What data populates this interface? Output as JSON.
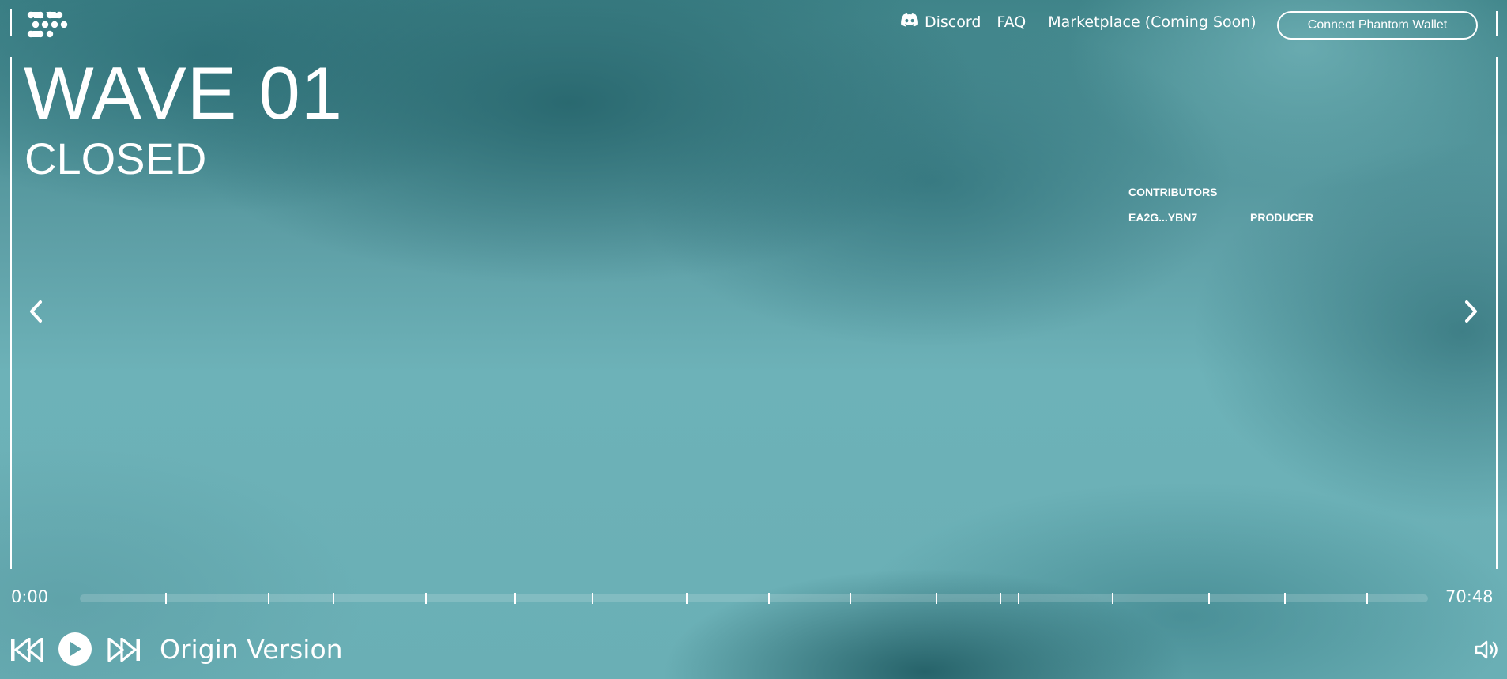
{
  "header": {
    "logo_icon": "wave-pattern-logo-icon",
    "nav": [
      {
        "label": "Discord",
        "icon": "discord-icon"
      },
      {
        "label": "FAQ"
      },
      {
        "label": "Marketplace (Coming Soon)"
      }
    ],
    "connect_button": "Connect Phantom Wallet"
  },
  "hero": {
    "title": "WAVE 01",
    "status": "CLOSED"
  },
  "contributors": {
    "heading": "CONTRIBUTORS",
    "rows": [
      {
        "address": "EA2G...YBN7",
        "role": "PRODUCER"
      }
    ]
  },
  "carousel": {
    "prev_icon": "chevron-left-icon",
    "next_icon": "chevron-right-icon"
  },
  "player": {
    "current_time": "0:00",
    "total_time": "70:48",
    "progress": 0,
    "track_name": "Origin Version",
    "icons": [
      "skip-back-icon",
      "play-icon",
      "skip-forward-icon",
      "volume-icon"
    ]
  },
  "colors": {
    "background_light": "#6aafb5",
    "background_dark": "#2e6f75",
    "foreground": "#ffffff"
  }
}
